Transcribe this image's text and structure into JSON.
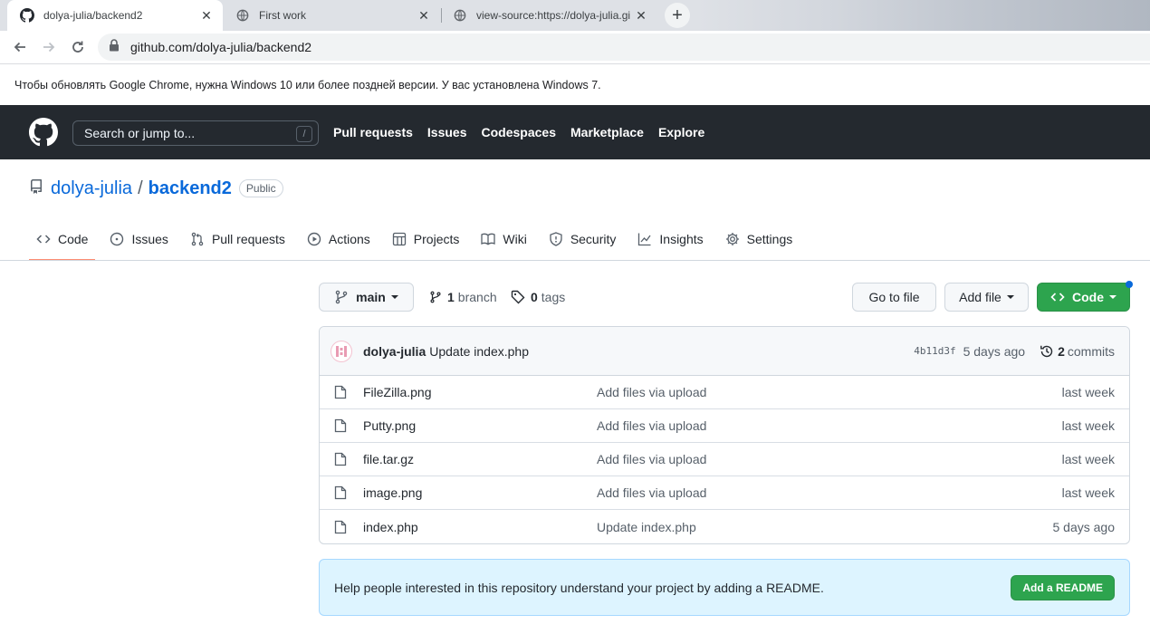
{
  "browser": {
    "tabs": [
      {
        "title": "dolya-julia/backend2",
        "active": true,
        "favicon": "github-icon"
      },
      {
        "title": "First work",
        "active": false,
        "favicon": "globe-icon"
      },
      {
        "title": "view-source:https://dolya-julia.gi",
        "active": false,
        "favicon": "globe-icon"
      }
    ],
    "new_tab_label": "+",
    "address": "github.com/dolya-julia/backend2"
  },
  "infobar": {
    "text": "Чтобы обновлять Google Chrome, нужна Windows 10 или более поздней версии. У вас установлена Windows 7."
  },
  "header": {
    "search_placeholder": "Search or jump to...",
    "search_shortcut": "/",
    "nav": [
      "Pull requests",
      "Issues",
      "Codespaces",
      "Marketplace",
      "Explore"
    ]
  },
  "repo": {
    "owner": "dolya-julia",
    "separator": "/",
    "name": "backend2",
    "visibility": "Public",
    "tabs": [
      {
        "label": "Code",
        "icon": "code-icon",
        "selected": true
      },
      {
        "label": "Issues",
        "icon": "issue-icon"
      },
      {
        "label": "Pull requests",
        "icon": "pull-request-icon"
      },
      {
        "label": "Actions",
        "icon": "play-icon"
      },
      {
        "label": "Projects",
        "icon": "table-icon"
      },
      {
        "label": "Wiki",
        "icon": "book-icon"
      },
      {
        "label": "Security",
        "icon": "shield-icon"
      },
      {
        "label": "Insights",
        "icon": "graph-icon"
      },
      {
        "label": "Settings",
        "icon": "gear-icon"
      }
    ]
  },
  "filenav": {
    "branch": "main",
    "branch_count": "1",
    "branch_label": "branch",
    "tag_count": "0",
    "tag_label": "tags",
    "go_to_file": "Go to file",
    "add_file": "Add file",
    "code": "Code"
  },
  "latest_commit": {
    "author": "dolya-julia",
    "message": "Update index.php",
    "sha": "4b11d3f",
    "age": "5 days ago",
    "commit_count": "2",
    "commit_label": "commits"
  },
  "files": [
    {
      "name": "FileZilla.png",
      "message": "Add files via upload",
      "age": "last week"
    },
    {
      "name": "Putty.png",
      "message": "Add files via upload",
      "age": "last week"
    },
    {
      "name": "file.tar.gz",
      "message": "Add files via upload",
      "age": "last week"
    },
    {
      "name": "image.png",
      "message": "Add files via upload",
      "age": "last week"
    },
    {
      "name": "index.php",
      "message": "Update index.php",
      "age": "5 days ago"
    }
  ],
  "readme_banner": {
    "text": "Help people interested in this repository understand your project by adding a README.",
    "button": "Add a README"
  },
  "colors": {
    "header_bg": "#24292f",
    "link": "#0969da",
    "green": "#2da44e",
    "underline": "#fd8c73",
    "banner_bg": "#ddf4ff"
  }
}
